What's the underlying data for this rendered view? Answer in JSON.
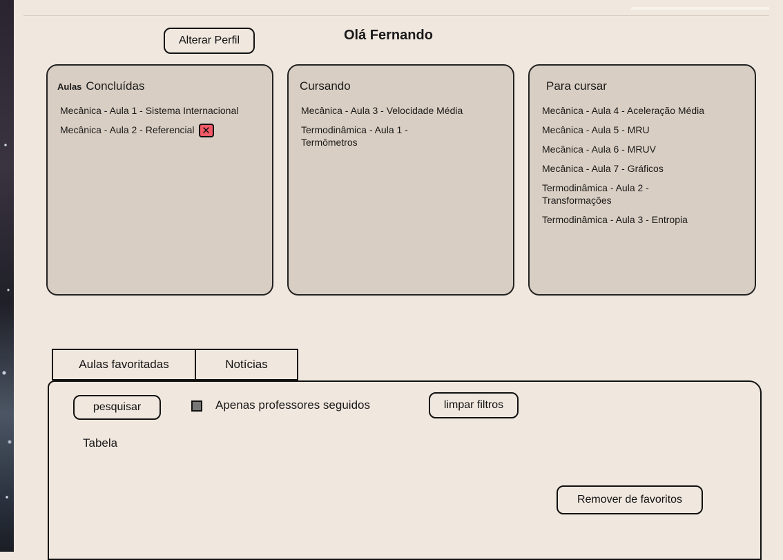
{
  "header": {
    "change_profile_label": "Alterar Perfil",
    "greeting": "Olá Fernando"
  },
  "cards": {
    "completed": {
      "prefix": "Aulas",
      "title": "Concluídas",
      "items": [
        "Mecânica - Aula 1 - Sistema Internacional",
        "Mecânica - Aula 2 - Referencial"
      ],
      "remove_icon": "close-icon",
      "remove_glyph": "✕",
      "remove_color": "#f15a66"
    },
    "in_progress": {
      "title": "Cursando",
      "items": [
        "Mecânica - Aula 3 - Velocidade Média",
        "Termodinâmica - Aula 1 - Termômetros"
      ]
    },
    "to_take": {
      "title": "Para cursar",
      "items": [
        "Mecânica - Aula 4 - Aceleração Média",
        "Mecânica - Aula 5 - MRU",
        "Mecânica - Aula 6 - MRUV",
        "Mecânica - Aula 7 - Gráficos",
        "Termodinâmica - Aula 2 - Transformações",
        "Termodinâmica - Aula 3 - Entropia"
      ]
    }
  },
  "tabs": [
    {
      "label": "Aulas favoritadas"
    },
    {
      "label": "Notícias"
    }
  ],
  "panel": {
    "search_label": "pesquisar",
    "filter_checkbox_label": "Apenas professores seguidos",
    "filter_checked": false,
    "clear_filters_label": "limpar filtros",
    "table_label": "Tabela",
    "remove_favorites_label": "Remover de favoritos"
  },
  "colors": {
    "background": "#f0e7de",
    "card_background": "#d9cec3",
    "checkbox_fill": "#777777"
  }
}
